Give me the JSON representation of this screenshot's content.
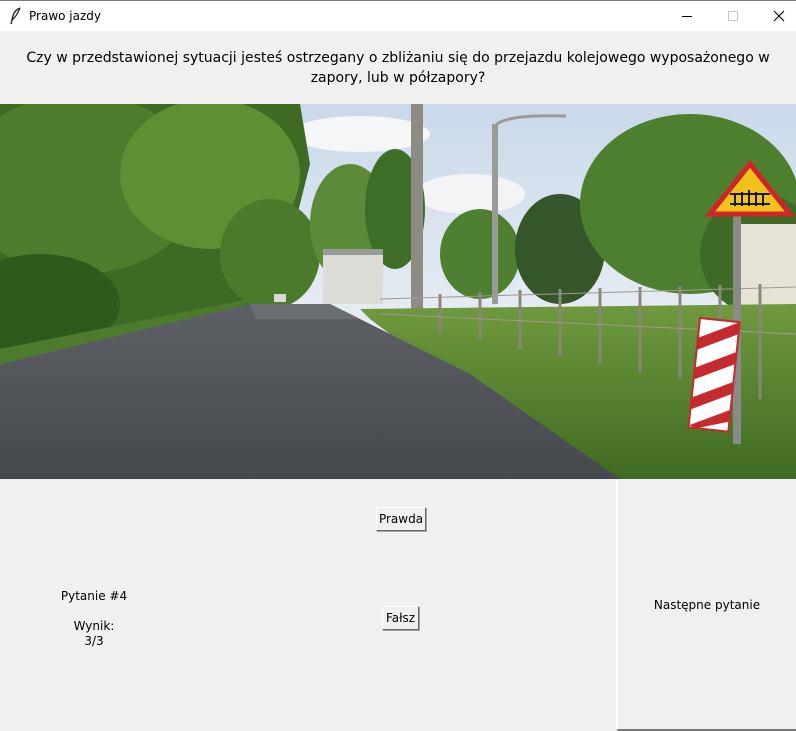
{
  "window": {
    "title": "Prawo jazdy",
    "app_icon": "feather-icon",
    "controls": [
      "minimize-icon",
      "maximize-icon",
      "close-icon"
    ]
  },
  "question": {
    "text": "Czy w przedstawionej sytuacji jesteś ostrzegany o zbliżaniu się do przejazdu kolejowego wyposażonego w zapory, lub w półzapory?"
  },
  "answers": {
    "true_label": "Prawda",
    "false_label": "Fałsz"
  },
  "status": {
    "question_label": "Pytanie #4",
    "score_label": "Wynik:",
    "score_value": "3/3"
  },
  "navigation": {
    "next_label": "Następne pytanie"
  }
}
